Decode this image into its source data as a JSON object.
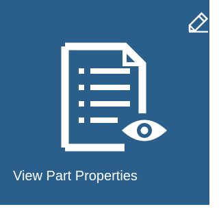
{
  "tile": {
    "label": "View Part Properties",
    "icon": "document-list-eye-icon",
    "background": "#2a5f8b"
  },
  "edit": {
    "icon": "pencil-icon"
  }
}
